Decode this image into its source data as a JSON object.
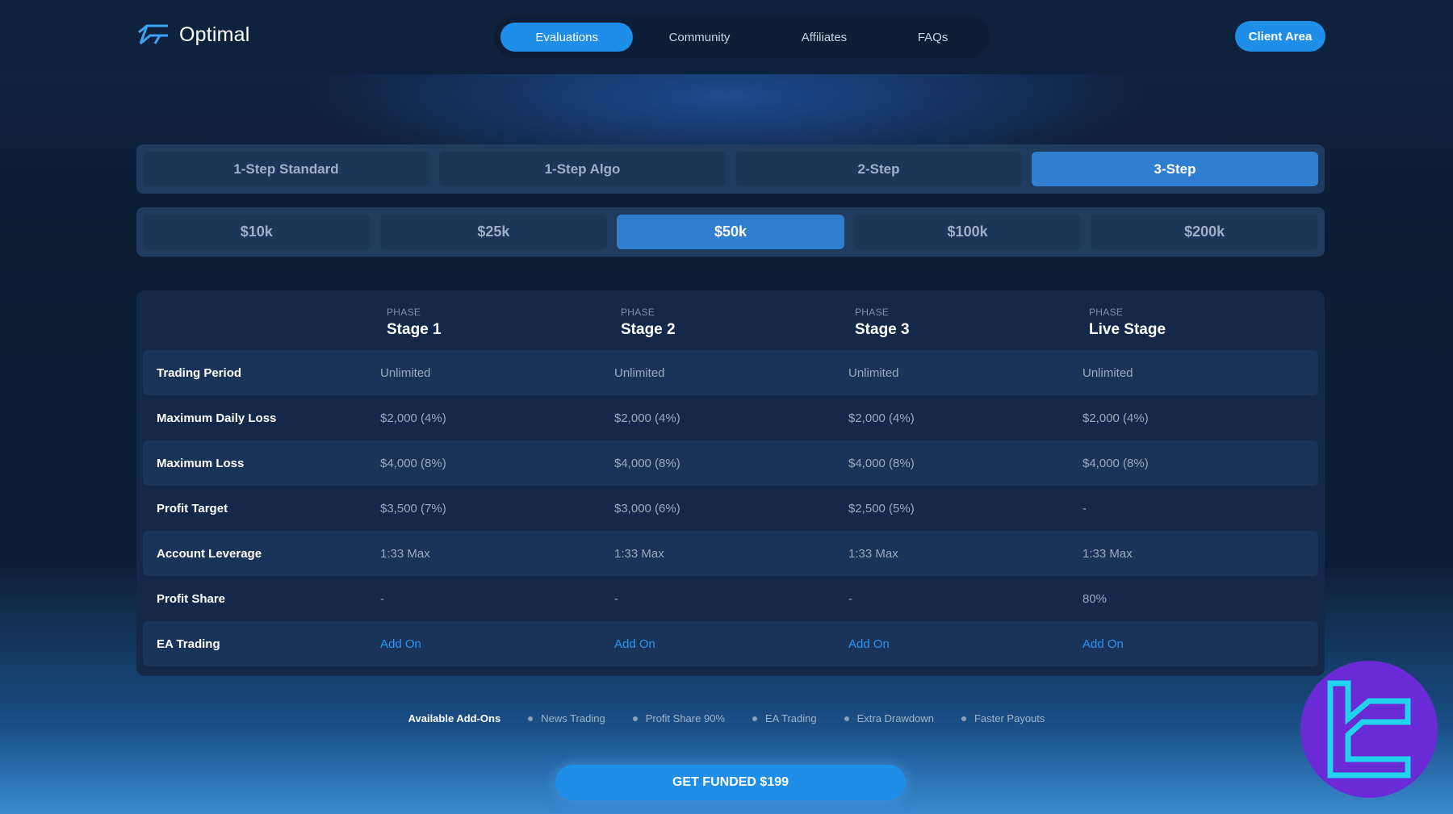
{
  "header": {
    "brand": "Optimal",
    "nav": [
      {
        "label": "Evaluations",
        "active": true
      },
      {
        "label": "Community",
        "active": false
      },
      {
        "label": "Affiliates",
        "active": false
      },
      {
        "label": "FAQs",
        "active": false
      }
    ],
    "client_area": "Client Area"
  },
  "program_tabs": [
    {
      "label": "1-Step Standard",
      "active": false
    },
    {
      "label": "1-Step Algo",
      "active": false
    },
    {
      "label": "2-Step",
      "active": false
    },
    {
      "label": "3-Step",
      "active": true
    }
  ],
  "size_tabs": [
    {
      "label": "$10k",
      "active": false
    },
    {
      "label": "$25k",
      "active": false
    },
    {
      "label": "$50k",
      "active": true
    },
    {
      "label": "$100k",
      "active": false
    },
    {
      "label": "$200k",
      "active": false
    }
  ],
  "table": {
    "phase_label": "PHASE",
    "phases": [
      "Stage 1",
      "Stage 2",
      "Stage 3",
      "Live Stage"
    ],
    "rows": [
      {
        "label": "Trading Period",
        "values": [
          "Unlimited",
          "Unlimited",
          "Unlimited",
          "Unlimited"
        ]
      },
      {
        "label": "Maximum Daily Loss",
        "values": [
          "$2,000 (4%)",
          "$2,000 (4%)",
          "$2,000 (4%)",
          "$2,000 (4%)"
        ]
      },
      {
        "label": "Maximum Loss",
        "values": [
          "$4,000 (8%)",
          "$4,000 (8%)",
          "$4,000 (8%)",
          "$4,000 (8%)"
        ]
      },
      {
        "label": "Profit Target",
        "values": [
          "$3,500 (7%)",
          "$3,000 (6%)",
          "$2,500 (5%)",
          "-"
        ]
      },
      {
        "label": "Account Leverage",
        "values": [
          "1:33 Max",
          "1:33 Max",
          "1:33 Max",
          "1:33 Max"
        ]
      },
      {
        "label": "Profit Share",
        "values": [
          "-",
          "-",
          "-",
          "80%"
        ]
      },
      {
        "label": "EA Trading",
        "values": [
          "Add On",
          "Add On",
          "Add On",
          "Add On"
        ]
      }
    ]
  },
  "addons": {
    "title": "Available Add-Ons",
    "items": [
      "News Trading",
      "Profit Share 90%",
      "EA Trading",
      "Extra Drawdown",
      "Faster Payouts"
    ]
  },
  "cta": "GET FUNDED $199",
  "colors": {
    "accent": "#1f8ee8",
    "link": "#2b95f0",
    "badge": "#6a2bd6",
    "badge_mark": "#22d3ee"
  },
  "icons": {
    "logo": "optimal-logo-icon",
    "watermark": "tc-badge-icon"
  }
}
